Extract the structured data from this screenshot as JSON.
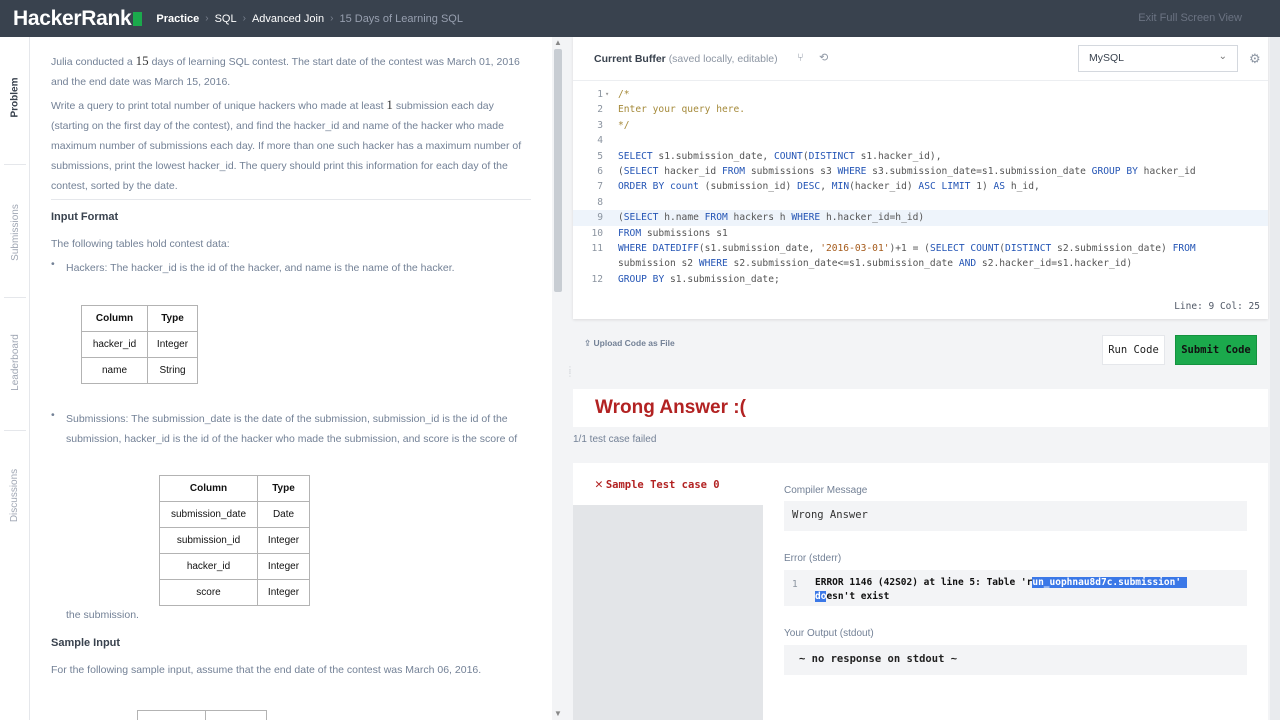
{
  "header": {
    "logo": "HackerRank",
    "crumbs": [
      "Practice",
      "SQL",
      "Advanced Join",
      "15 Days of Learning SQL"
    ],
    "exit_fullscreen": "Exit Full Screen View"
  },
  "side_tabs": [
    "Problem",
    "Submissions",
    "Leaderboard",
    "Discussions"
  ],
  "problem": {
    "p1_a": "Julia conducted a ",
    "p1_num": "15",
    "p1_b": " days of learning SQL contest. The start date of the contest was March 01, 2016 and the end date was March 15, 2016.",
    "p2_a": "Write a query to print total number of unique hackers who made at least ",
    "p2_num": "1",
    "p2_b": " submission each day (starting on the first day of the contest), and find the hacker_id and name of the hacker who made maximum number of submissions each day. If more than one such hacker has a maximum number of submissions, print the lowest hacker_id. The query should print this information for each day of the contest, sorted by the date.",
    "input_format_heading": "Input Format",
    "tables_intro": "The following tables hold contest data:",
    "hackers_desc": "Hackers: The hacker_id is the id of the hacker, and name is the name of the hacker.",
    "hackers_table": {
      "headers": [
        "Column",
        "Type"
      ],
      "rows": [
        [
          "hacker_id",
          "Integer"
        ],
        [
          "name",
          "String"
        ]
      ]
    },
    "submissions_desc": "Submissions: The submission_date is the date of the submission, submission_id is the id of the submission, hacker_id is the id of the hacker who made the submission, and score is the score of",
    "submissions_table": {
      "headers": [
        "Column",
        "Type"
      ],
      "rows": [
        [
          "submission_date",
          "Date"
        ],
        [
          "submission_id",
          "Integer"
        ],
        [
          "hacker_id",
          "Integer"
        ],
        [
          "score",
          "Integer"
        ]
      ]
    },
    "submissions_tail": "the submission.",
    "sample_input_heading": "Sample Input",
    "sample_input_text": "For the following sample input, assume that the end date of the contest was March 06, 2016."
  },
  "editor": {
    "title": "Current Buffer",
    "subtitle": "(saved locally, editable)",
    "language": "MySQL",
    "status": "Line: 9 Col: 25",
    "highlighted_line": 9,
    "lines": [
      "/*",
      "Enter your query here.",
      "*/",
      "",
      "SELECT s1.submission_date, COUNT(DISTINCT s1.hacker_id),",
      "(SELECT hacker_id FROM submissions s3 WHERE s3.submission_date=s1.submission_date GROUP BY hacker_id",
      "ORDER BY count (submission_id) DESC, MIN(hacker_id) ASC LIMIT 1) AS h_id,",
      "",
      "(SELECT h.name FROM hackers h WHERE h.hacker_id=h_id)",
      "FROM submissions s1",
      "WHERE DATEDIFF(s1.submission_date, '2016-03-01')+1 = (SELECT COUNT(DISTINCT s2.submission_date) FROM",
      "submission s2 WHERE s2.submission_date<=s1.submission_date AND s2.hacker_id=s1.hacker_id)",
      "GROUP BY s1.submission_date;"
    ],
    "line_numbers": [
      "1",
      "2",
      "3",
      "4",
      "5",
      "6",
      "7",
      "8",
      "9",
      "10",
      "11",
      "",
      "12"
    ]
  },
  "actions": {
    "upload": "Upload Code as File",
    "run": "Run Code",
    "submit": "Submit Code"
  },
  "result": {
    "title": "Wrong Answer :(",
    "summary": "1/1 test case failed",
    "test_case": "Sample Test case 0",
    "compiler_label": "Compiler Message",
    "compiler_message": "Wrong Answer",
    "error_label": "Error (stderr)",
    "error_line_no": "1",
    "error_a": "ERROR 1146 (42S02) at line 5: Table 'r",
    "error_sel1": "un_uophnau8d7c.submission' ",
    "error_sel2": "do",
    "error_b": "esn't exist",
    "output_label": "Your Output (stdout)",
    "output": "~ no response on stdout ~"
  },
  "colors": {
    "topbar": "#39424e",
    "accent_green": "#1ba94c",
    "error_red": "#b22222",
    "selection": "#3b78e7"
  }
}
